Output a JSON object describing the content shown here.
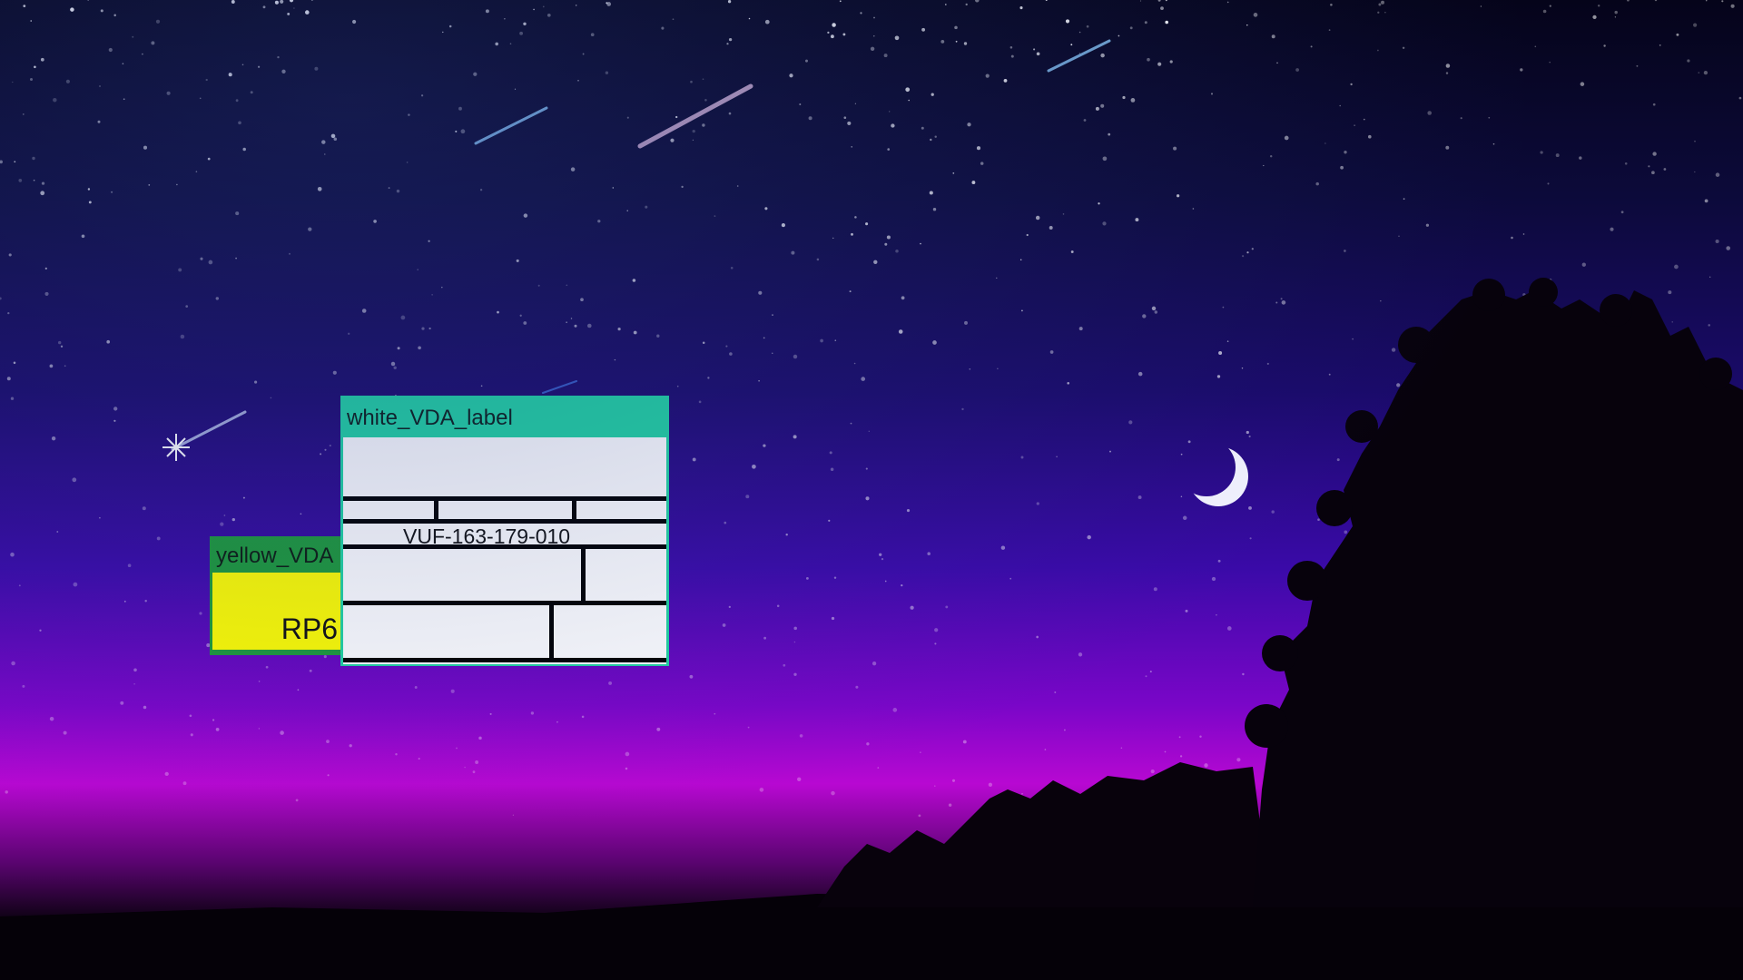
{
  "desktop": {
    "wallpaper": "night sky with shooting stars, crescent moon and tree silhouette",
    "colors": {
      "sky_top": "#05041a",
      "sky_mid": "#3a0aa8",
      "horizon_glow": "#b808d2",
      "ground": "#050108"
    }
  },
  "windows": {
    "yellow": {
      "title": "yellow_VDA",
      "code": "RP6",
      "title_color": "#1e9a3a",
      "body_color": "#ffff00"
    },
    "white": {
      "title": "white_VDA_label",
      "code": "VUF-163-179-010",
      "title_color": "#22d4a2",
      "body_color": "#ffffff"
    }
  },
  "icons": {
    "moon": "crescent-moon-icon",
    "tree": "tree-silhouette-icon"
  }
}
